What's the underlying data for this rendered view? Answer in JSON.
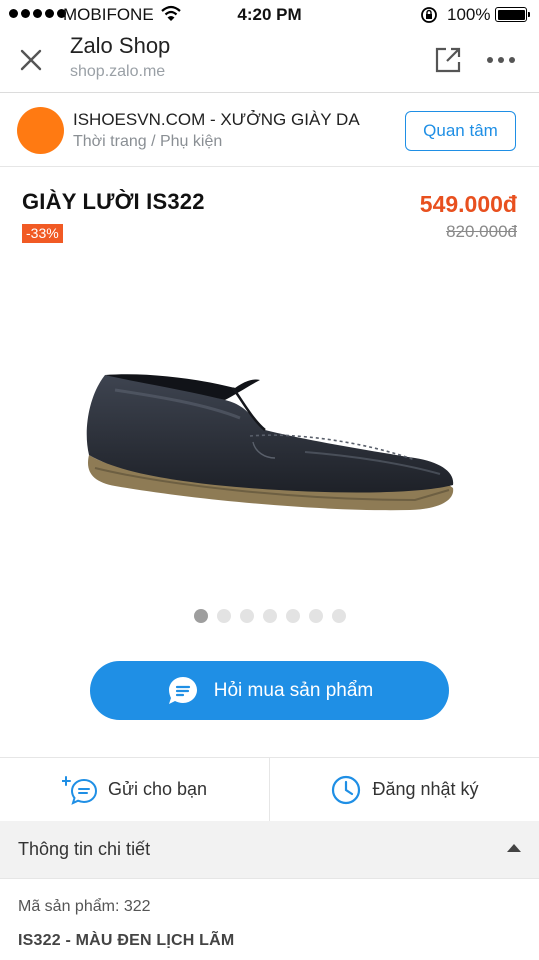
{
  "status_bar": {
    "carrier": "MOBIFONE",
    "time": "4:20 PM",
    "battery": "100%"
  },
  "header": {
    "title": "Zalo Shop",
    "url": "shop.zalo.me",
    "icons": [
      "close-icon",
      "share-icon",
      "more-icon"
    ]
  },
  "shop": {
    "name": "ISHOESVN.COM - XƯỞNG GIÀY DA",
    "category": "Thời trang / Phụ kiện",
    "follow_label": "Quan tâm",
    "avatar_color": "#ff7a12"
  },
  "product": {
    "name": "GIÀY LƯỜI IS322",
    "discount": "-33%",
    "price": "549.000đ",
    "old_price": "820.000đ",
    "image_count": 7,
    "active_image": 1
  },
  "actions": {
    "ask_label": "Hỏi mua sản phẩm",
    "send_label": "Gửi cho bạn",
    "diary_label": "Đăng nhật ký"
  },
  "details": {
    "title": "Thông tin chi tiết",
    "sku_line": "Mã sản phẩm: 322",
    "description": "IS322 - MÀU ĐEN LỊCH LÃM"
  },
  "colors": {
    "accent": "#1f8fe5",
    "price": "#e8501f",
    "discount_badge": "#f15a24"
  }
}
